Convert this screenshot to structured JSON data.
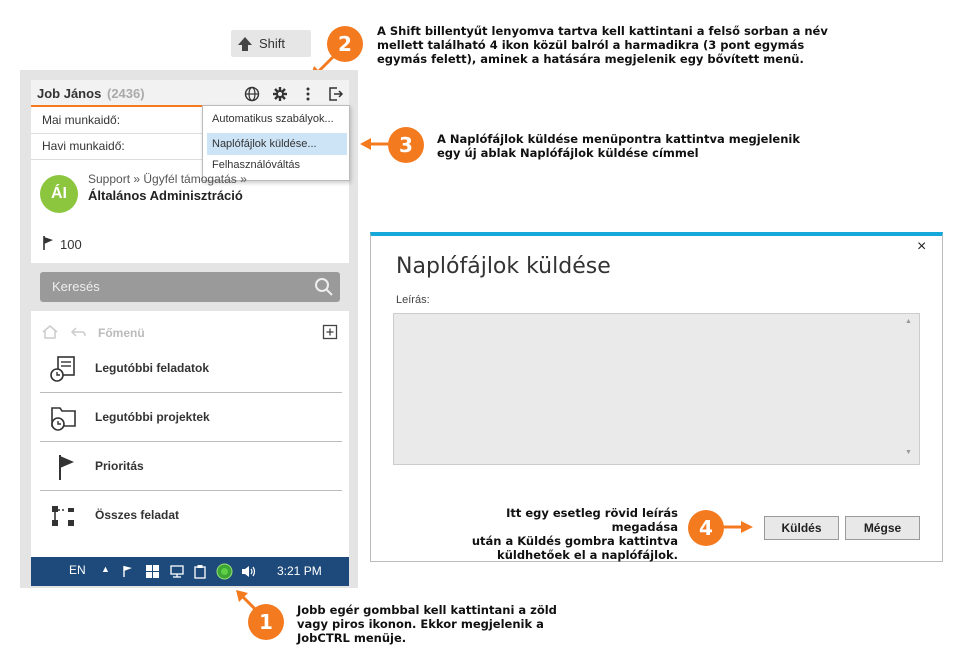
{
  "shift_key": {
    "label": "Shift"
  },
  "badges": {
    "one": "1",
    "two": "2",
    "three": "3",
    "four": "4"
  },
  "notes": {
    "step2": [
      "A Shift billentyűt lenyomva tartva kell kattintani a felső sorban a név",
      "mellett található 4 ikon közül balról a harmadikra (3 pont egymás",
      "egymás felett), aminek a hatására megjelenik egy bővített menü."
    ],
    "step3": [
      "A Naplófájlok küldése menüpontra kattintva megjelenik",
      "egy új ablak Naplófájlok küldése címmel"
    ],
    "step4": [
      "Itt egy esetleg rövid leírás megadása",
      "után a Küldés gombra kattintva",
      "küldhetőek el a naplófájlok."
    ],
    "step1": [
      "Jobb egér gombbal kell kattintani a zöld",
      "vagy piros ikonon. Ekkor megjelenik a",
      "JobCTRL menüje."
    ]
  },
  "panel": {
    "user_name": "Job János",
    "user_id": "(2436)",
    "daily_label": "Mai munkaidő:",
    "monthly_label": "Havi munkaidő:",
    "menu": [
      "Automatikus szabályok...",
      "Naplófájlok küldése...",
      "Felhasználóváltás"
    ],
    "avatar_initials": "ÁI",
    "breadcrumb": "Support » Ügyfél támogatás »",
    "task_title": "Általános Adminisztráció",
    "priority": "100",
    "search_placeholder": "Keresés",
    "home_label": "Főmenü",
    "nav": [
      "Legutóbbi feladatok",
      "Legutóbbi projektek",
      "Prioritás",
      "Összes feladat"
    ]
  },
  "taskbar": {
    "lang": "EN",
    "time": "3:21 PM"
  },
  "dialog": {
    "title": "Naplófájlok küldése",
    "desc_label": "Leírás:",
    "desc_value": "",
    "send_label": "Küldés",
    "cancel_label": "Mégse",
    "close_glyph": "×"
  },
  "colors": {
    "accent": "#f47a20",
    "dialog_border": "#15a8d8",
    "avatar": "#8cc63e",
    "taskbar": "#1d4a7a"
  }
}
